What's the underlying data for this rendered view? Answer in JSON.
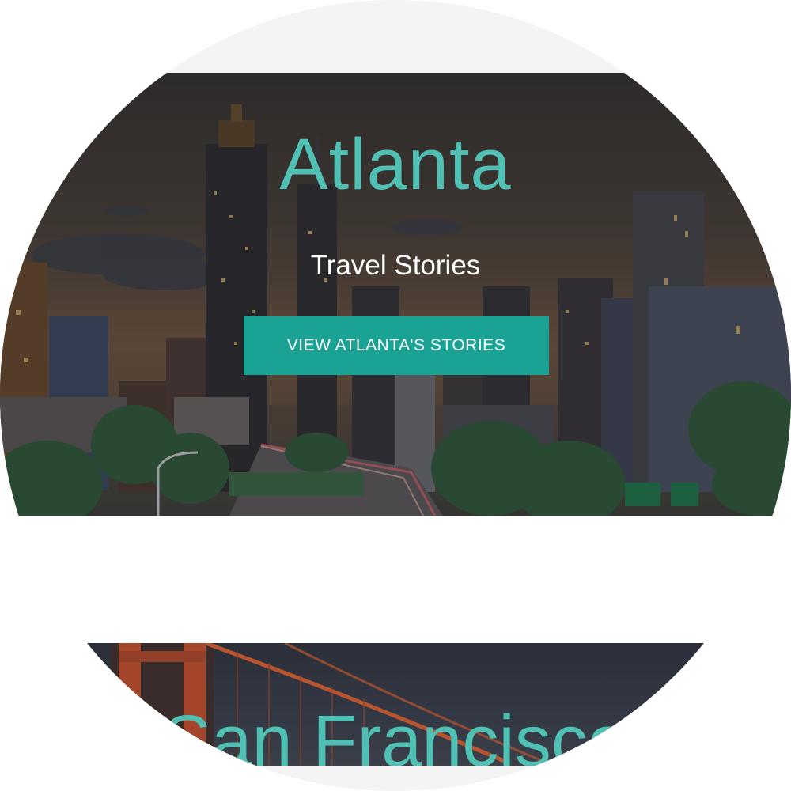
{
  "atlanta": {
    "title": "Atlanta",
    "subtitle": "Travel Stories",
    "button_label": "VIEW ATLANTA'S STORIES"
  },
  "san_francisco": {
    "title": "San Francisco"
  },
  "colors": {
    "accent_text": "#4fc0b3",
    "button_bg": "#1aa394",
    "subtitle_text": "#ffffff"
  }
}
